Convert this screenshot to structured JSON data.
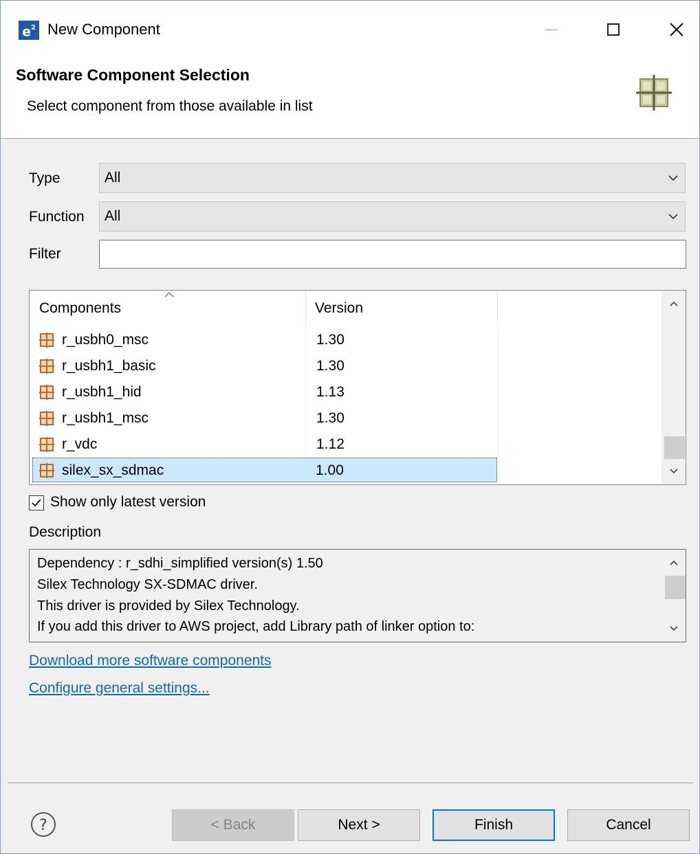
{
  "window": {
    "app_icon_text": "e",
    "app_icon_sup": "2",
    "title": "New Component"
  },
  "banner": {
    "title": "Software Component Selection",
    "subtitle": "Select component from those available in list",
    "icon": "component-grid-icon"
  },
  "form": {
    "type_label": "Type",
    "type_value": "All",
    "function_label": "Function",
    "function_value": "All",
    "filter_label": "Filter",
    "filter_value": ""
  },
  "table": {
    "columns": [
      "Components",
      "Version"
    ],
    "rows": [
      {
        "name": "r_usbh0_msc",
        "version": "1.30"
      },
      {
        "name": "r_usbh1_basic",
        "version": "1.30"
      },
      {
        "name": "r_usbh1_hid",
        "version": "1.13"
      },
      {
        "name": "r_usbh1_msc",
        "version": "1.30"
      },
      {
        "name": "r_vdc",
        "version": "1.12"
      },
      {
        "name": "silex_sx_sdmac",
        "version": "1.00",
        "selected": true
      }
    ],
    "scroll_position": 0.95
  },
  "show_latest": {
    "label": "Show only latest version",
    "checked": true
  },
  "description": {
    "label": "Description",
    "lines": [
      "Dependency : r_sdhi_simplified version(s) 1.50",
      "Silex Technology SX-SDMAC driver.",
      "This driver is provided by Silex Technology.",
      "If you add this driver to AWS project, add Library path of linker option to:"
    ]
  },
  "links": {
    "download": "Download more software components",
    "configure": "Configure general settings..."
  },
  "buttons": {
    "back": "< Back",
    "next": "Next >",
    "finish": "Finish",
    "cancel": "Cancel"
  },
  "colors": {
    "accent": "#0078d7",
    "selection": "#cce8ff",
    "link": "#0a6ab5",
    "component_icon": "#c0682a"
  }
}
